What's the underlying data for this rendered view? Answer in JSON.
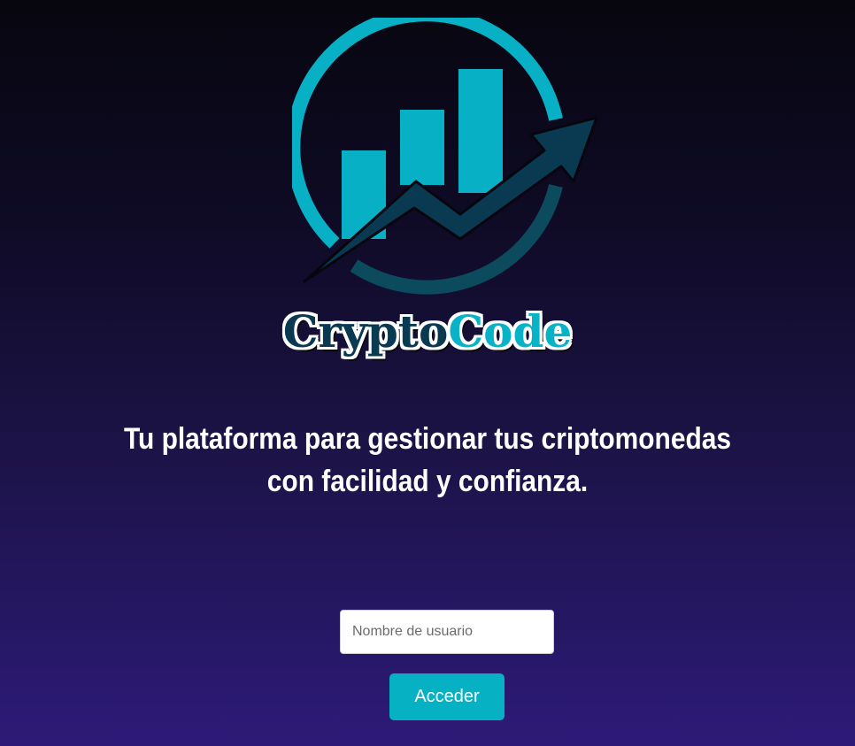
{
  "brand": {
    "name_part1": "Crypto",
    "name_part2": "Code",
    "colors": {
      "dark": "#0a3a52",
      "accent": "#08b3c8"
    }
  },
  "tagline": "Tu plataforma para gestionar tus criptomonedas con facilidad y confianza.",
  "login": {
    "username_placeholder": "Nombre de usuario",
    "username_value": "",
    "submit_label": "Acceder",
    "button_color": "#06b1c4"
  },
  "logo": {
    "icon": "growth-chart-icon"
  }
}
